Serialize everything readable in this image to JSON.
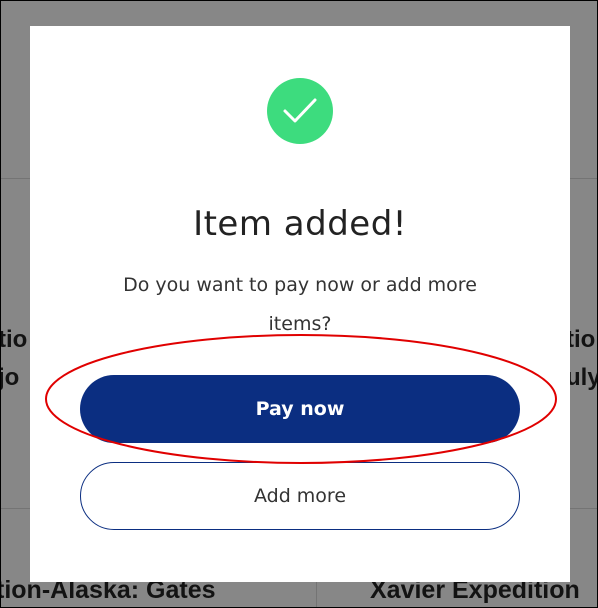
{
  "background": {
    "left_fragment_1": "tio",
    "left_fragment_2": "jo",
    "right_fragment_1": "tio",
    "right_fragment_2": "uly",
    "bottom_left_title": "tion-Alaska: Gates",
    "bottom_right_title": "Xavier Expedition"
  },
  "modal": {
    "icon": "check-circle-icon",
    "title": "Item added!",
    "message": "Do you want to pay now or add more items?",
    "pay_now_label": "Pay now",
    "add_more_label": "Add more"
  },
  "colors": {
    "success": "#3ddc7e",
    "primary": "#0b2e81",
    "highlight": "#e00000"
  }
}
